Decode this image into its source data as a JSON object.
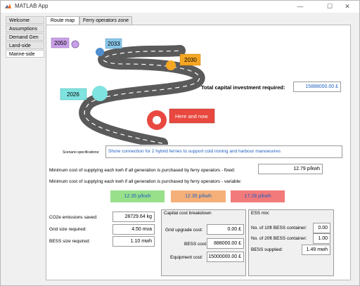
{
  "window": {
    "title": "MATLAB App",
    "minimize_glyph": "—",
    "maximize_glyph": "☐",
    "close_glyph": "✕"
  },
  "sidebar": {
    "items": [
      {
        "label": "Welcome"
      },
      {
        "label": "Assumptions"
      },
      {
        "label": "Demand Gen"
      },
      {
        "label": "Land-side"
      },
      {
        "label": "Marine-side"
      }
    ]
  },
  "tabs": [
    {
      "label": "Route map"
    },
    {
      "label": "Ferry operators zone"
    }
  ],
  "roadmap": {
    "milestones": [
      "2050",
      "2033",
      "2030",
      "2026",
      "Here and now"
    ],
    "colors": {
      "2050": "#c9a0e8",
      "2033": "#8ac7ea",
      "2030": "#f5a623",
      "2026": "#7fe3e0",
      "now": "#e8483f"
    }
  },
  "capital": {
    "label": "Total capital investment required:",
    "value": "15888000.00 £"
  },
  "scenario": {
    "label": "Scenario specifications:",
    "value": "Shore connection for 2 hybrid ferries to support cold ironing and harbour manoeuvres"
  },
  "min_cost_fixed": {
    "label": "Minimum cost of supplying each kwh if all generation is purchased by ferry operators - fixed:",
    "value": "12.79 p/kwh"
  },
  "min_cost_variable": {
    "label": "Minimum cost of supplying each kwh if all generation is purchased by ferry operators - variable:"
  },
  "variable_rates": [
    {
      "value": "12.35 p/kwh",
      "color": "#98e08a"
    },
    {
      "value": "12.35 p/kwh",
      "color": "#f5b07a"
    },
    {
      "value": "17.28 p/kwh",
      "color": "#f27a7a"
    }
  ],
  "stats": {
    "co2": {
      "label": "CO2e emissions saved:",
      "value": "28729.64 kg"
    },
    "grid": {
      "label": "Grid size required:",
      "value": "4.50 mva"
    },
    "bess": {
      "label": "BESS size required:",
      "value": "1.10 mwh"
    }
  },
  "capital_breakdown": {
    "title": "Capital cost breakdown",
    "grid_upgrade": {
      "label": "Grid upgrade cost:",
      "value": "0.00 £"
    },
    "bess": {
      "label": "BESS cost:",
      "value": "888000.00 £"
    },
    "equipment": {
      "label": "Equipment cost:",
      "value": "15000000.00 £"
    }
  },
  "ess_mix": {
    "title": "ESS mix:",
    "ten_ft": {
      "label": "No. of 10ft BESS container:",
      "value": "0.00"
    },
    "twenty_ft": {
      "label": "No. of 20ft BESS container:",
      "value": "1.00"
    },
    "supplied": {
      "label": "BESS supplied:",
      "value": "1.49 mwh"
    }
  }
}
